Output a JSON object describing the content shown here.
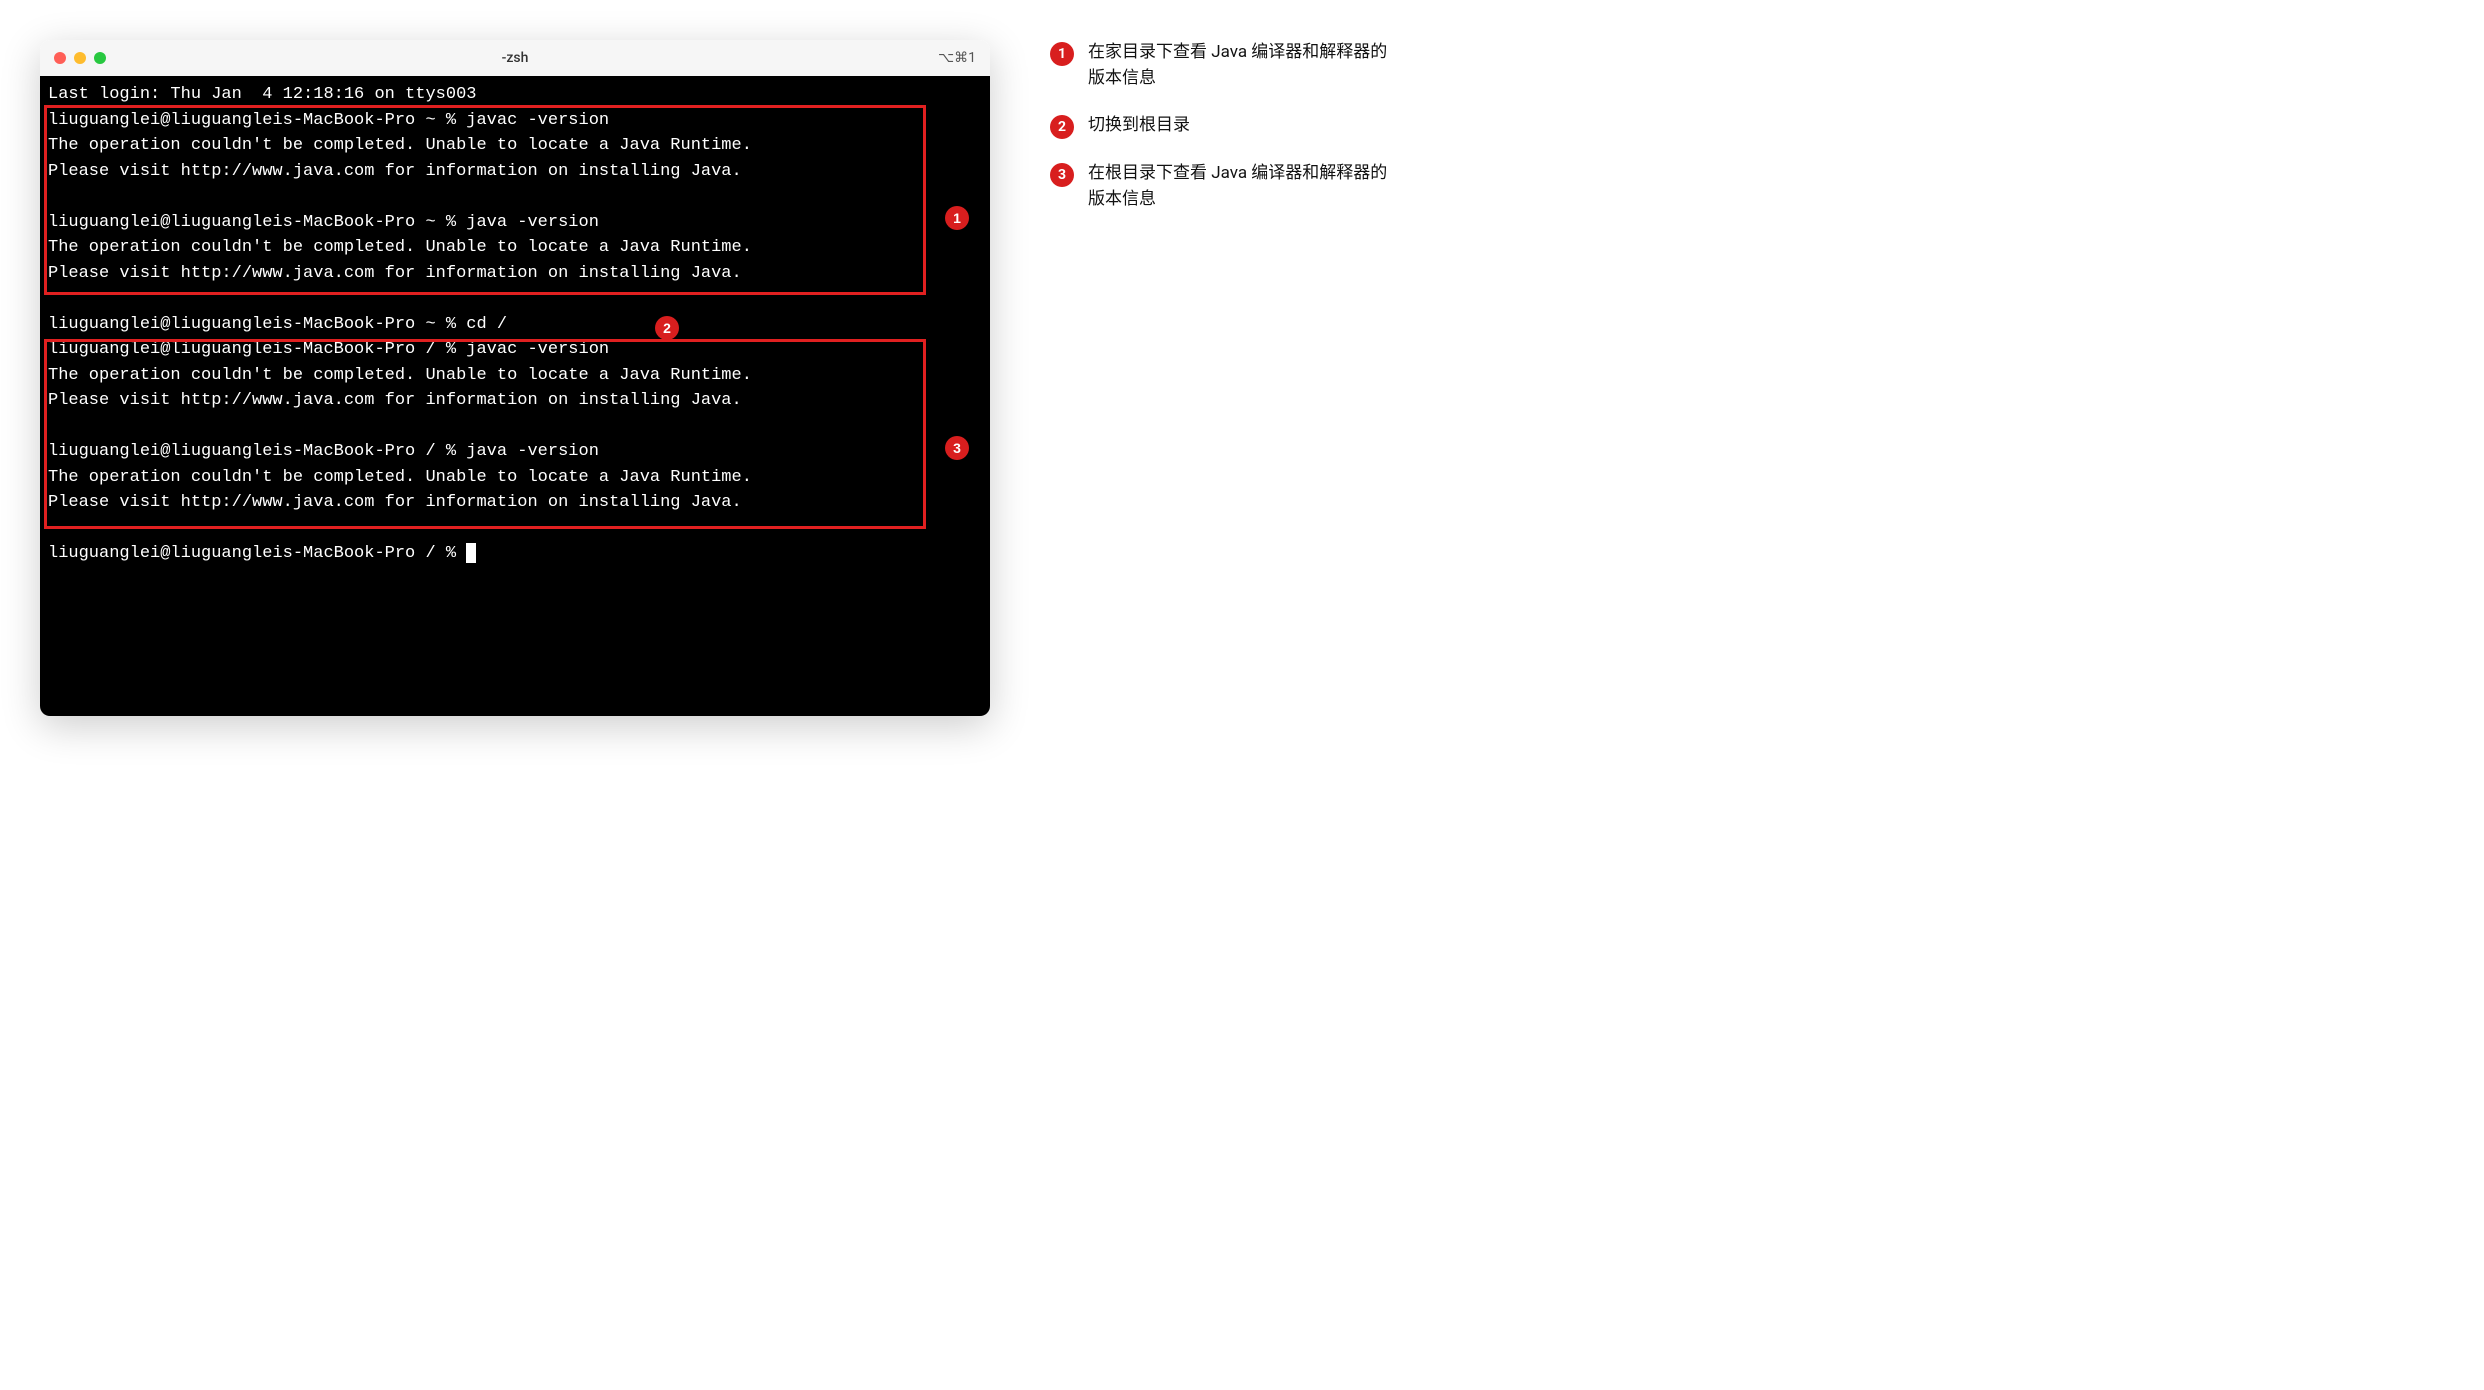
{
  "window": {
    "title": "-zsh",
    "shortcut": "⌥⌘1"
  },
  "terminal": {
    "lines": [
      "Last login: Thu Jan  4 12:18:16 on ttys003",
      "liuguanglei@liuguangleis-MacBook-Pro ~ % javac -version",
      "The operation couldn't be completed. Unable to locate a Java Runtime.",
      "Please visit http://www.java.com for information on installing Java.",
      "",
      "liuguanglei@liuguangleis-MacBook-Pro ~ % java -version",
      "The operation couldn't be completed. Unable to locate a Java Runtime.",
      "Please visit http://www.java.com for information on installing Java.",
      "",
      "liuguanglei@liuguangleis-MacBook-Pro ~ % cd /",
      "liuguanglei@liuguangleis-MacBook-Pro / % javac -version",
      "The operation couldn't be completed. Unable to locate a Java Runtime.",
      "Please visit http://www.java.com for information on installing Java.",
      "",
      "liuguanglei@liuguangleis-MacBook-Pro / % java -version",
      "The operation couldn't be completed. Unable to locate a Java Runtime.",
      "Please visit http://www.java.com for information on installing Java.",
      ""
    ],
    "final_prompt": "liuguanglei@liuguangleis-MacBook-Pro / % "
  },
  "markers": {
    "m1": "1",
    "m2": "2",
    "m3": "3"
  },
  "annotations": [
    {
      "num": "1",
      "text": "在家目录下查看 Java 编译器和解释器的版本信息"
    },
    {
      "num": "2",
      "text": "切换到根目录"
    },
    {
      "num": "3",
      "text": "在根目录下查看 Java 编译器和解释器的版本信息"
    }
  ]
}
